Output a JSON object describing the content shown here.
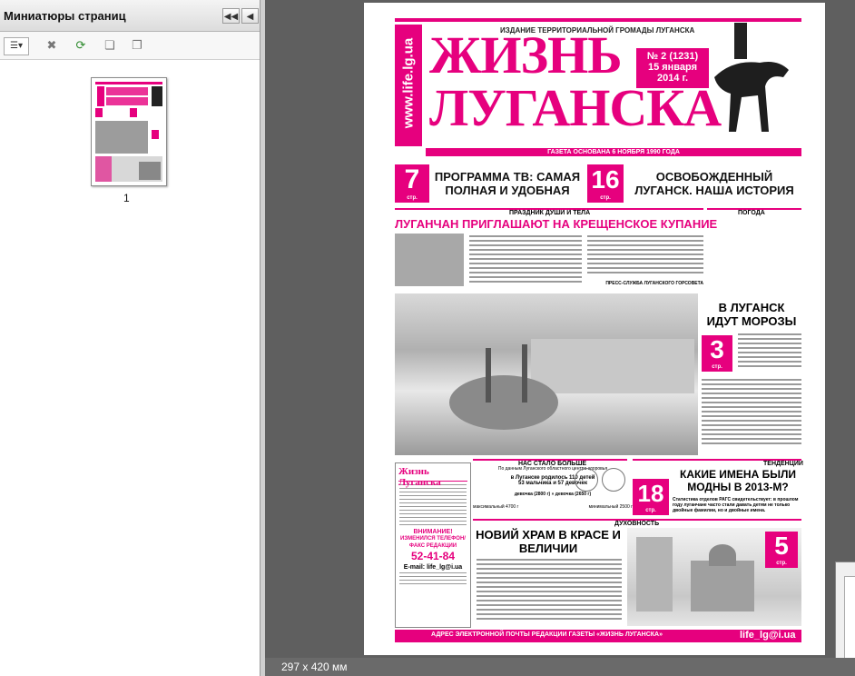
{
  "sidebar": {
    "title": "Миниатюры страниц",
    "collapse_label": "◀◀",
    "close_label": "◀",
    "options_label": "☰▾",
    "thumbnail_page_number": "1"
  },
  "status": {
    "page_size": "297 x 420 мм"
  },
  "newspaper": {
    "url_vertical": "www.life.lg.ua",
    "subtitle": "ИЗДАНИЕ ТЕРРИТОРИАЛЬНОЙ ГРОМАДЫ ЛУГАНСКА",
    "title_line1": "Жизнь",
    "title_line2": "Луганска",
    "issue": "№ 2 (1231)",
    "date_line1": "15 января",
    "date_line2": "2014 г.",
    "founded": "ГАЗЕТА ОСНОВАНА 6 НОЯБРЯ 1990 ГОДА",
    "teaser1_num": "7",
    "teaser1_page": "стр.",
    "teaser1_text": "ПРОГРАММА ТВ: САМАЯ ПОЛНАЯ И УДОБНАЯ",
    "teaser2_num": "16",
    "teaser2_page": "стр.",
    "teaser2_text": "ОСВОБОЖДЕННЫЙ ЛУГАНСК. НАША ИСТОРИЯ",
    "rubric_holiday": "ПРАЗДНИК ДУШИ И ТЕЛА",
    "rubric_weather": "ПОГОДА",
    "headline_main": "ЛУГАНЧАН ПРИГЛАШАЮТ НА КРЕЩЕНСКОЕ КУПАНИЕ",
    "signature_press": "ПРЕСС-СЛУЖБА ЛУГАНСКОГО ГОРСОВЕТА",
    "weather_headline": "В ЛУГАНСК ИДУТ МОРОЗЫ",
    "weather_num": "3",
    "weather_page": "стр.",
    "rubric_more": "НАС СТАЛО БОЛЬШЕ",
    "rubric_trends": "ТЕНДЕНЦИИ",
    "births_source": "По данным Луганского областного центра здоровья",
    "births_line1": "в Луганске родилось 110 детей",
    "births_line2": "53 мальчика и 57 девочек",
    "births_boys": "девочка (2800 г) » девочка (2650 г)",
    "births_max": "максимальный 4700 г",
    "births_min": "минимальный 2500 г",
    "names_headline": "КАКИЕ ИМЕНА БЫЛИ МОДНЫ В 2013-М?",
    "names_num": "18",
    "names_page": "стр.",
    "names_lead": "Статистика отделов РАГС свидетельствует: в прошлом году луганчане часто стали давать детям не только двойные фамилии, но и двойные имена.",
    "rubric_spirit": "ДУХОВНОСТЬ",
    "temple_headline": "НОВИЙ ХРАМ В КРАСЕ И ВЕЛИЧИИ",
    "temple_num": "5",
    "temple_page": "стр.",
    "box_logo": "Жизнь Луганска",
    "box_attention": "ВНИМАНИЕ!",
    "box_phone_title": "ИЗМЕНИЛСЯ ТЕЛЕФОН/ФАКС РЕДАКЦИИ",
    "box_phone": "52-41-84",
    "box_email": "E-mail: life_lg@i.ua",
    "footer_label": "АДРЕС ЭЛЕКТРОННОЙ ПОЧТЫ РЕДАКЦИИ ГАЗЕТЫ «ЖИЗНЬ ЛУГАНСКА»",
    "footer_email": "life_lg@i.ua"
  },
  "colors": {
    "brand": "#e6007e",
    "pane_bg": "#5f5f5f"
  }
}
